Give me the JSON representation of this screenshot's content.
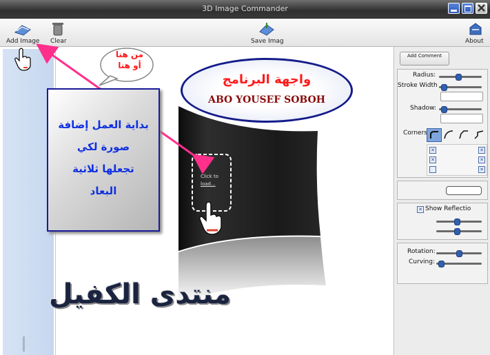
{
  "window": {
    "title": "3D Image Commander"
  },
  "toolbar": {
    "add_image": "Add Image",
    "clear": "Clear",
    "save_image": "Save Imag",
    "about": "About"
  },
  "canvas": {
    "placeholder_line1": "Click to",
    "placeholder_line2": "load..."
  },
  "right_panel": {
    "add_comment": "Add Comment",
    "radius": "Radius:",
    "stroke_width": "Stroke Width",
    "shadow": "Shadow:",
    "corners": "Corners",
    "show_reflection": "Show Reflectio",
    "rotation": "Rotation:",
    "curving": "Curving:",
    "radius_level": 0.45,
    "stroke_level": 0.05,
    "shadow_level": 0.05,
    "reflection_level_1": 0.45,
    "reflection_level_2": 0.45,
    "rotation_level": 0.5,
    "curving_level": 0.05
  },
  "annotations": {
    "bubble_line1": "من هنا",
    "bubble_line2": "أو هنا",
    "oval_line1": "واجهة البرنامج",
    "oval_line2": "ABO YOUSEF SOBOH",
    "box_line1": "بداية العمل إضافة",
    "box_line2": "صورة لكي",
    "box_line3": "تجعلها ثلاثية",
    "box_line4": "البعاد",
    "watermark": "منتدى الكفيل"
  },
  "colors": {
    "arrow": "#ff2f8c",
    "annotation_red": "#ff1a1a",
    "annotation_blue": "#1030e0",
    "oval_border": "#141c8a",
    "box_border": "#1a1a9a"
  },
  "icons": {
    "add_image": "add-image-icon",
    "clear": "trash-icon",
    "save_image": "save-image-icon",
    "about": "about-icon",
    "hand_cursor": "hand-cursor-icon"
  }
}
